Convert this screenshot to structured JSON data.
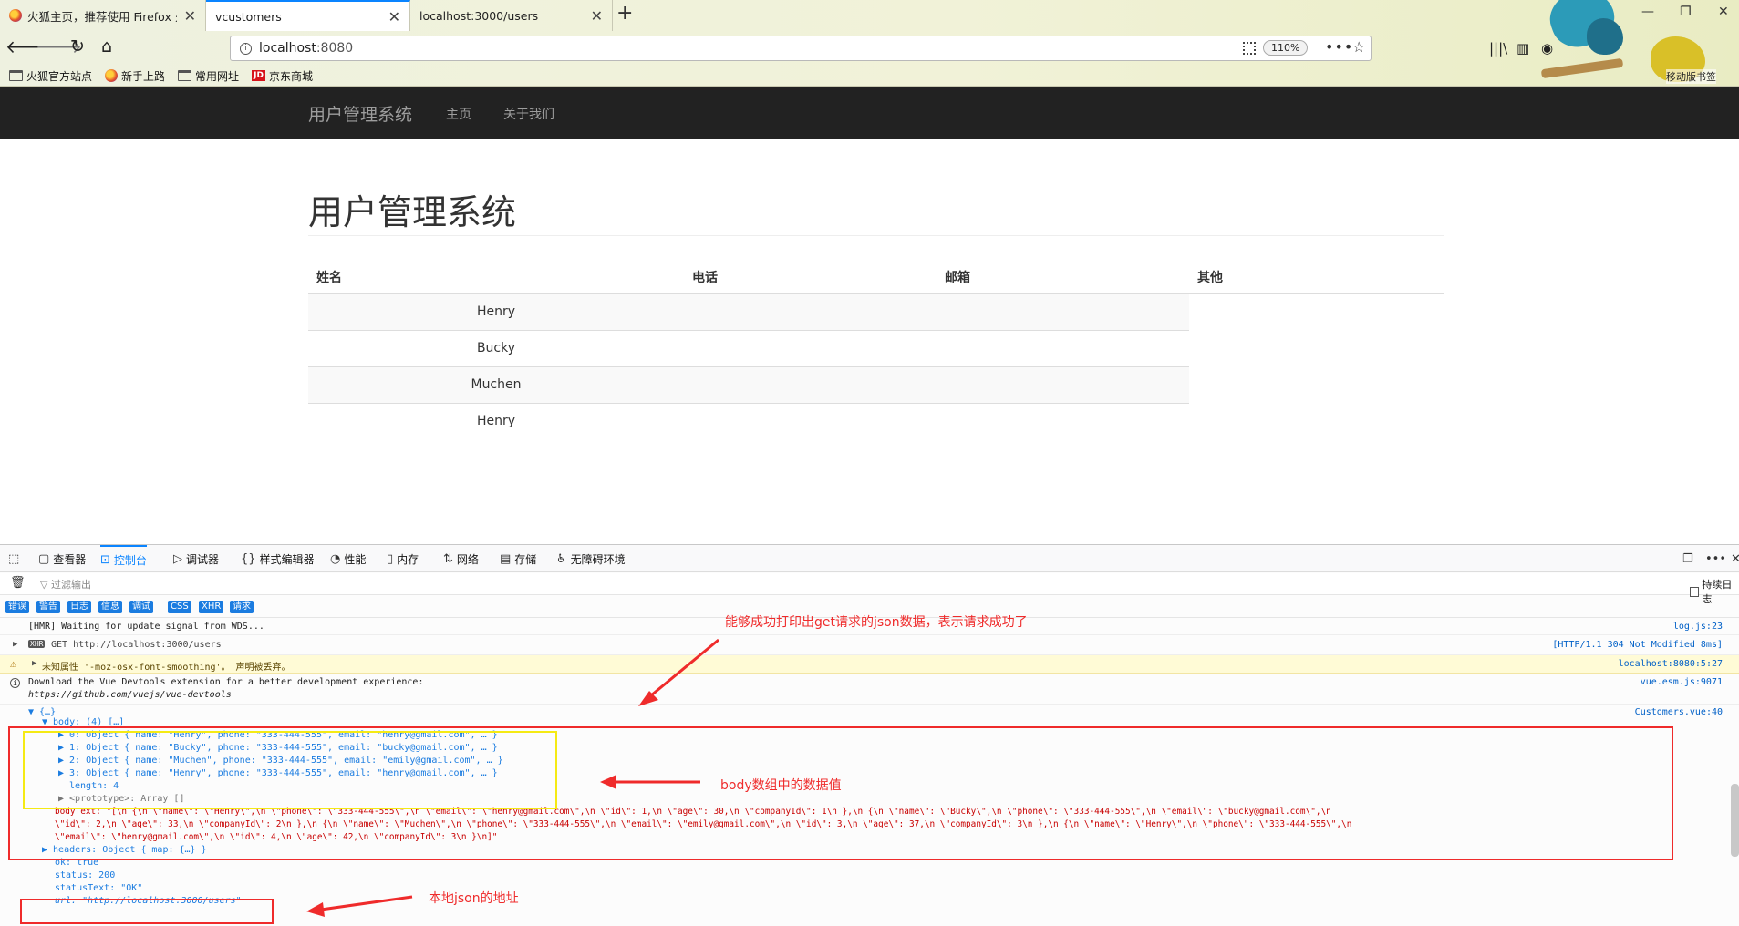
{
  "browser": {
    "tabs": [
      {
        "label": "火狐主页，推荐使用 Firefox 火",
        "active": false
      },
      {
        "label": "vcustomers",
        "active": true
      },
      {
        "label": "localhost:3000/users",
        "active": false
      }
    ],
    "url_host": "localhost",
    "url_port": ":8080",
    "zoom": "110%",
    "bookmarks": [
      {
        "label": "火狐官方站点",
        "icon": "folder-icon"
      },
      {
        "label": "新手上路",
        "icon": "firefox-icon"
      },
      {
        "label": "常用网址",
        "icon": "folder-icon"
      },
      {
        "label": "京东商城",
        "icon": "jd-icon"
      }
    ],
    "mobile_bookmarks": "移动版书签"
  },
  "app": {
    "brand": "用户管理系统",
    "nav": [
      "主页",
      "关于我们"
    ],
    "page_title": "用户管理系统",
    "table": {
      "headers": [
        "姓名",
        "电话",
        "邮箱",
        "其他"
      ],
      "rows": [
        "Henry",
        "Bucky",
        "Muchen",
        "Henry"
      ]
    }
  },
  "devtools": {
    "tabs": [
      {
        "label": "查看器",
        "icon": "inspector-icon"
      },
      {
        "label": "控制台",
        "icon": "console-icon",
        "active": true
      },
      {
        "label": "调试器",
        "icon": "debugger-icon"
      },
      {
        "label": "样式编辑器",
        "icon": "style-editor-icon"
      },
      {
        "label": "性能",
        "icon": "performance-icon"
      },
      {
        "label": "内存",
        "icon": "memory-icon"
      },
      {
        "label": "网络",
        "icon": "network-icon"
      },
      {
        "label": "存储",
        "icon": "storage-icon"
      },
      {
        "label": "无障碍环境",
        "icon": "accessibility-icon"
      }
    ],
    "filter_placeholder": "过滤输出",
    "persist_label": "持续日志",
    "filter_buttons": [
      "错误",
      "警告",
      "日志",
      "信息",
      "调试",
      "CSS",
      "XHR",
      "请求"
    ],
    "console": {
      "hmr": {
        "msg": "[HMR] Waiting for update signal from WDS...",
        "src": "log.js:23"
      },
      "xhr": {
        "badge": "XHR",
        "msg": "GET http://localhost:3000/users",
        "src": "[HTTP/1.1  304 Not Modified 8ms]"
      },
      "warn": {
        "msg": "未知属性 '-moz-osx-font-smoothing'。  声明被丢弃。",
        "src": "localhost:8080:5:27"
      },
      "info": {
        "line1": "Download the Vue Devtools extension for a better development experience:",
        "line2": "https://github.com/vuejs/vue-devtools",
        "src": "vue.esm.js:9071"
      },
      "object_open": {
        "msg": "▼ {…}",
        "src": "Customers.vue:40"
      },
      "body_label": "▼ body: (4) […]",
      "body_items": [
        "▶ 0: Object { name: \"Henry\", phone: \"333-444-555\", email: \"henry@gmail.com\", … }",
        "▶ 1: Object { name: \"Bucky\", phone: \"333-444-555\", email: \"bucky@gmail.com\", … }",
        "▶ 2: Object { name: \"Muchen\", phone: \"333-444-555\", email: \"emily@gmail.com\", … }",
        "▶ 3: Object { name: \"Henry\", phone: \"333-444-555\", email: \"henry@gmail.com\", … }"
      ],
      "length": "length: 4",
      "prototype": "▶ <prototype>: Array []",
      "bodytext_1": "bodyText: \"[\\n  {\\n    \\\"name\\\": \\\"Henry\\\",\\n    \\\"phone\\\": \\\"333-444-555\\\",\\n    \\\"email\\\": \\\"henry@gmail.com\\\",\\n    \\\"id\\\": 1,\\n    \\\"age\\\": 30,\\n    \\\"companyId\\\": 1\\n  },\\n  {\\n    \\\"name\\\": \\\"Bucky\\\",\\n    \\\"phone\\\": \\\"333-444-555\\\",\\n    \\\"email\\\": \\\"bucky@gmail.com\\\",\\n",
      "bodytext_2": "\\\"id\\\": 2,\\n    \\\"age\\\": 33,\\n    \\\"companyId\\\": 2\\n  },\\n  {\\n    \\\"name\\\": \\\"Muchen\\\",\\n    \\\"phone\\\": \\\"333-444-555\\\",\\n    \\\"email\\\": \\\"emily@gmail.com\\\",\\n    \\\"id\\\": 3,\\n    \\\"age\\\": 37,\\n    \\\"companyId\\\": 3\\n  },\\n  {\\n    \\\"name\\\": \\\"Henry\\\",\\n    \\\"phone\\\": \\\"333-444-555\\\",\\n",
      "bodytext_3": "\\\"email\\\": \\\"henry@gmail.com\\\",\\n    \\\"id\\\": 4,\\n    \\\"age\\\": 42,\\n    \\\"companyId\\\": 3\\n  }\\n]\"",
      "headers": "▶ headers: Object { map: {…} }",
      "ok": "ok: true",
      "status": "status: 200",
      "statustext": "statusText: \"OK\"",
      "url": "url: \"http://localhost:3000/users\""
    }
  },
  "annotations": {
    "top": "能够成功打印出get请求的json数据，表示请求成功了",
    "body": "body数组中的数据值",
    "url": "本地json的地址"
  },
  "colors": {
    "annotation_red": "#ef2b2b",
    "highlight_yellow": "#f5ea14",
    "accent_blue": "#0a84ff",
    "navbar_dark": "#222222"
  }
}
